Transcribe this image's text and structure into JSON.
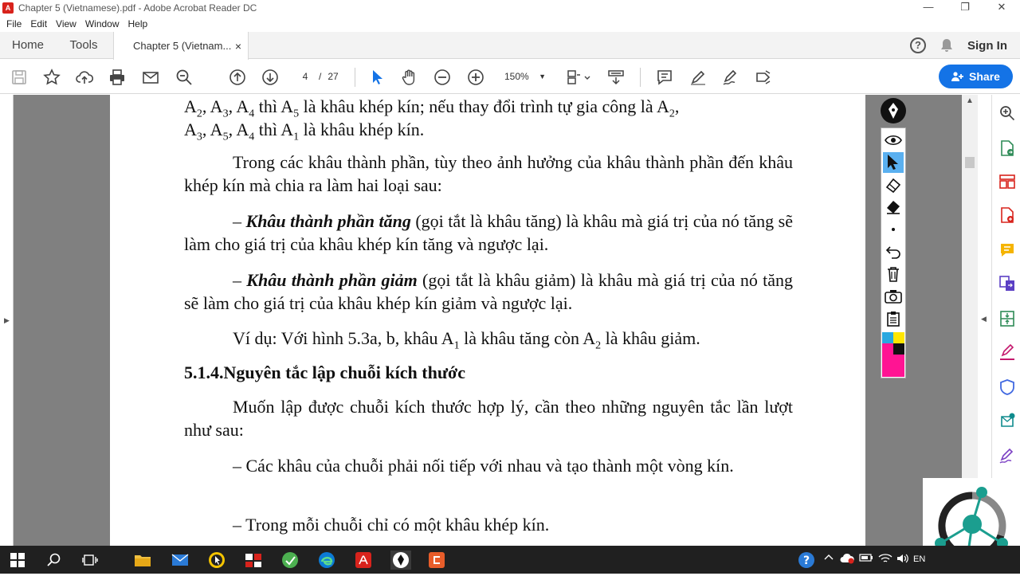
{
  "window": {
    "title": "Chapter 5 (Vietnamese).pdf - Adobe Acrobat Reader DC",
    "minimize": "—",
    "maximize": "❐",
    "close": "✕"
  },
  "menu": [
    "File",
    "Edit",
    "View",
    "Window",
    "Help"
  ],
  "tabs": {
    "home": "Home",
    "tools": "Tools",
    "document": "Chapter 5 (Vietnam...",
    "close": "×",
    "signin": "Sign In",
    "help": "?"
  },
  "toolbar": {
    "page_current": "4",
    "page_separator": "/",
    "page_total": "27",
    "zoom": "150%",
    "share_label": "Share"
  },
  "document": {
    "p1": [
      "A",
      "2",
      ", A",
      "3",
      ", A",
      "4",
      " thì A",
      "5",
      " là khâu khép kín; nếu thay đổi trình tự gia công là A",
      "2",
      ",",
      "A",
      "3",
      ", A",
      "5",
      ", A",
      "4",
      " thì A",
      "1",
      " là khâu khép kín."
    ],
    "p2": "Trong các khâu thành phần, tùy theo ảnh hưởng của khâu thành phần đến khâu khép kín mà chia ra làm hai loại sau:",
    "p3_dash": "–",
    "p3_term": "Khâu thành phần tăng",
    "p3_rest": " (gọi tắt là khâu tăng) là khâu mà giá trị của nó tăng sẽ làm cho giá trị của khâu khép kín tăng và ngược lại.",
    "p4_dash": "–",
    "p4_term": "Khâu thành phần giảm",
    "p4_rest": " (gọi tắt là khâu giảm) là khâu mà giá trị của nó tăng sẽ làm cho giá trị của khâu khép kín giảm và ngược lại.",
    "p5": [
      "Ví dụ: Với hình 5.3a, b, khâu A",
      "1",
      " là khâu tăng còn A",
      "2",
      " là khâu giảm."
    ],
    "heading_num": "5.1.4.",
    "heading_text": "Nguyên tắc lập chuỗi kích thước",
    "p6": "Muốn lập được chuỗi kích thước hợp lý, cần theo những nguyên tắc lần lượt như sau:",
    "p7": "– Các khâu của chuỗi phải nối tiếp với nhau và tạo thành một vòng kín.",
    "p8": "– Trong mỗi chuỗi chỉ có một khâu khép kín."
  },
  "taskbar": {
    "lang": "EN"
  },
  "colors": {
    "accent": "#1473e6",
    "acrobat_red": "#d8231c",
    "taskbar": "#202020"
  }
}
